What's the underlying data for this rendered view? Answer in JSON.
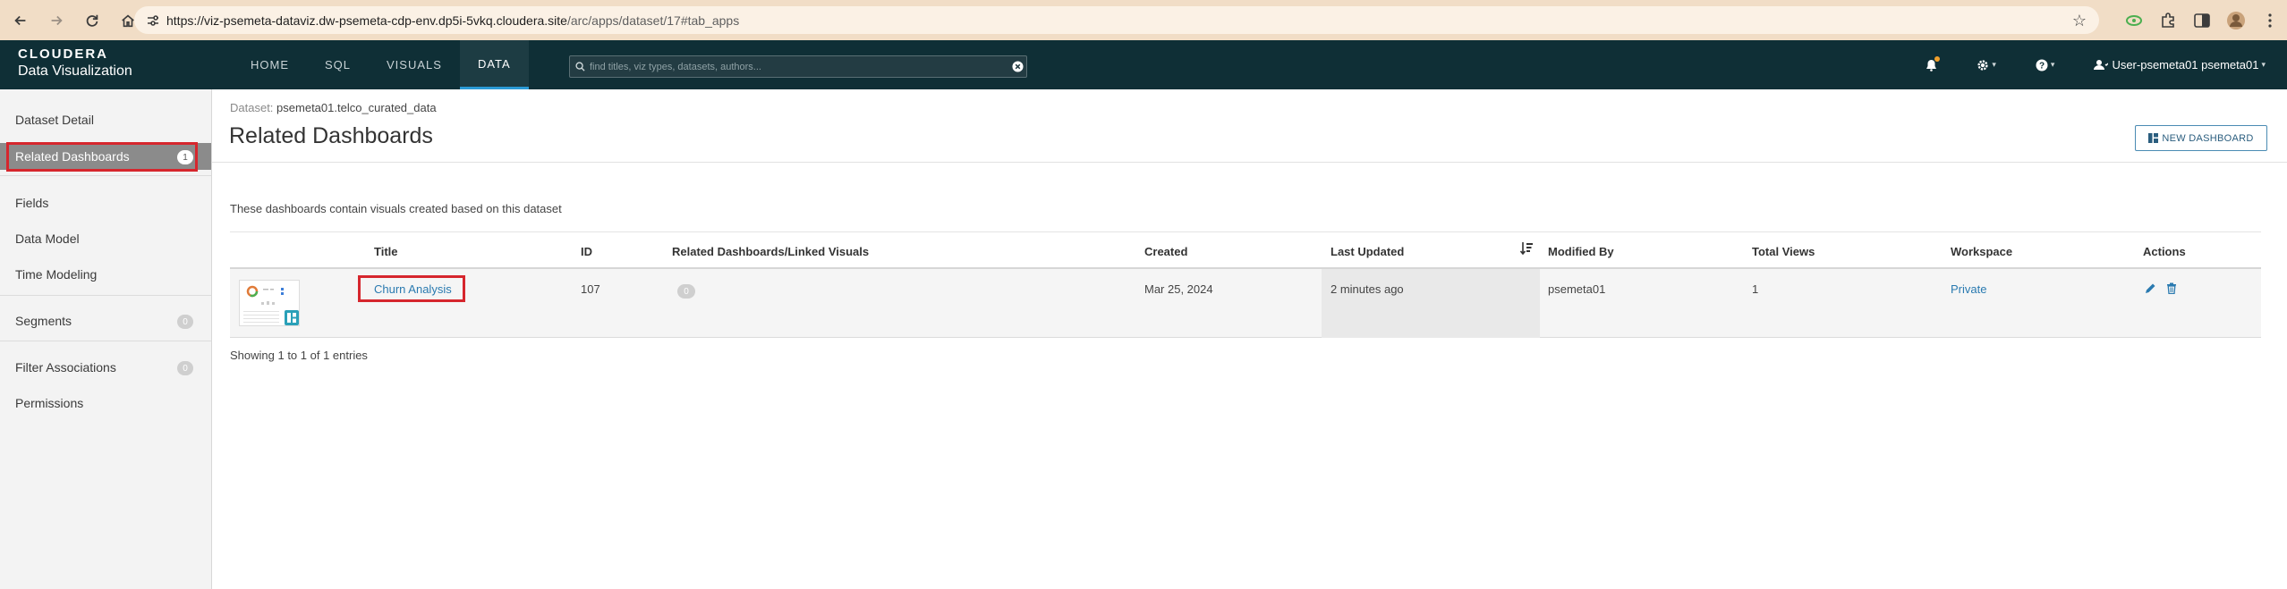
{
  "browser": {
    "url_host": "https://viz-psemeta-dataviz.dw-psemeta-cdp-env.dp5i-5vkq.cloudera.site",
    "url_path": "/arc/apps/dataset/17#tab_apps"
  },
  "brand": {
    "line1": "CLOUDERA",
    "line2": "Data Visualization"
  },
  "nav": {
    "tabs": [
      {
        "label": "HOME"
      },
      {
        "label": "SQL"
      },
      {
        "label": "VISUALS"
      },
      {
        "label": "DATA"
      }
    ],
    "active": "DATA",
    "search_placeholder": "find titles, viz types, datasets, authors...",
    "user_label": "User-psemeta01 psemeta01"
  },
  "sidebar": {
    "items": [
      {
        "label": "Dataset Detail",
        "badge": ""
      },
      {
        "label": "Related Dashboards",
        "badge": "1"
      },
      {
        "label": "Fields",
        "badge": ""
      },
      {
        "label": "Data Model",
        "badge": ""
      },
      {
        "label": "Time Modeling",
        "badge": ""
      },
      {
        "label": "Segments",
        "badge": "0"
      },
      {
        "label": "Filter Associations",
        "badge": "0"
      },
      {
        "label": "Permissions",
        "badge": ""
      }
    ]
  },
  "main": {
    "breadcrumb_prefix": "Dataset:",
    "dataset_name": "psemeta01.telco_curated_data",
    "title": "Related Dashboards",
    "new_dashboard_label": "NEW DASHBOARD",
    "description": "These dashboards contain visuals created based on this dataset",
    "table": {
      "headers": {
        "title": "Title",
        "id": "ID",
        "related": "Related Dashboards/Linked Visuals",
        "created": "Created",
        "last_updated": "Last Updated",
        "modified_by": "Modified By",
        "total_views": "Total Views",
        "workspace": "Workspace",
        "actions": "Actions"
      },
      "rows": [
        {
          "title": "Churn Analysis",
          "id": "107",
          "related_count": "0",
          "created": "Mar 25, 2024",
          "last_updated": "2 minutes ago",
          "modified_by": "psemeta01",
          "total_views": "1",
          "workspace": "Private"
        }
      ]
    },
    "showing": "Showing 1 to 1 of 1 entries"
  },
  "colors": {
    "header_bg": "#0f2f36",
    "active_tab_underline": "#2b9bd6",
    "link": "#2a7ab0",
    "highlight": "#d6262d"
  }
}
